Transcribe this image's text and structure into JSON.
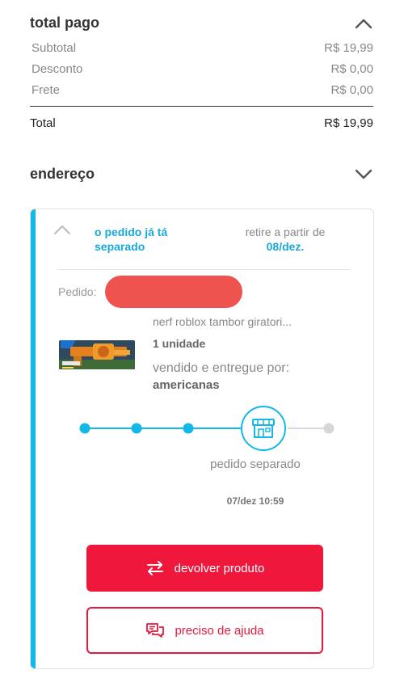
{
  "summary": {
    "title": "total pago",
    "rows": [
      {
        "label": "Subtotal",
        "value": "R$ 19,99"
      },
      {
        "label": "Desconto",
        "value": "R$ 0,00"
      },
      {
        "label": "Frete",
        "value": "R$ 0,00"
      }
    ],
    "total_label": "Total",
    "total_value": "R$ 19,99"
  },
  "address": {
    "title": "endereço"
  },
  "order": {
    "status": "o pedido já tá separado",
    "pickup_label": "retire a partir de",
    "pickup_date": "08/dez.",
    "order_label": "Pedido:",
    "product": {
      "name": "nerf roblox tambor giratori...",
      "quantity": "1 unidade",
      "seller_label": "vendido e entregue por:",
      "seller": "americanas"
    },
    "tracking": {
      "current_step": "pedido separado",
      "current_date": "07/dez 10:59",
      "steps_completed": 4,
      "steps_total": 5
    },
    "buttons": {
      "return": "devolver produto",
      "help": "preciso de ajuda"
    }
  },
  "colors": {
    "accent_blue": "#19a8d8",
    "brand_red": "#f0173c",
    "redaction": "#ef5350"
  },
  "icons": [
    "chevron-up-icon",
    "chevron-down-icon",
    "store-icon",
    "swap-arrows-icon",
    "chat-bubbles-icon"
  ]
}
